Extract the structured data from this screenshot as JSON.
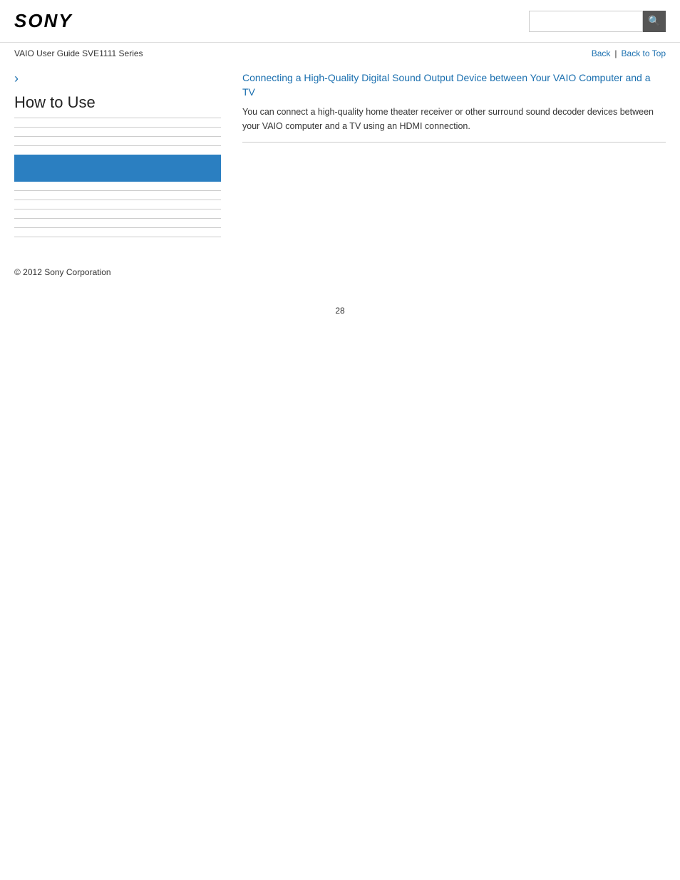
{
  "header": {
    "logo": "SONY",
    "search_placeholder": "",
    "search_icon": "🔍"
  },
  "subheader": {
    "guide_title": "VAIO User Guide SVE1111 Series",
    "nav": {
      "back_label": "Back",
      "separator": "|",
      "back_to_top_label": "Back to Top"
    }
  },
  "sidebar": {
    "chevron": "›",
    "title": "How to Use",
    "lines": [
      "line1",
      "line2",
      "line3",
      "highlight",
      "line4",
      "line5",
      "line6",
      "line7",
      "line8",
      "line9"
    ]
  },
  "content": {
    "article": {
      "title": "Connecting a High-Quality Digital Sound Output Device between Your VAIO Computer and a TV",
      "description": "You can connect a high-quality home theater receiver or other surround sound decoder devices between your VAIO computer and a TV using an HDMI connection."
    }
  },
  "footer": {
    "copyright": "© 2012 Sony Corporation"
  },
  "page": {
    "number": "28"
  }
}
